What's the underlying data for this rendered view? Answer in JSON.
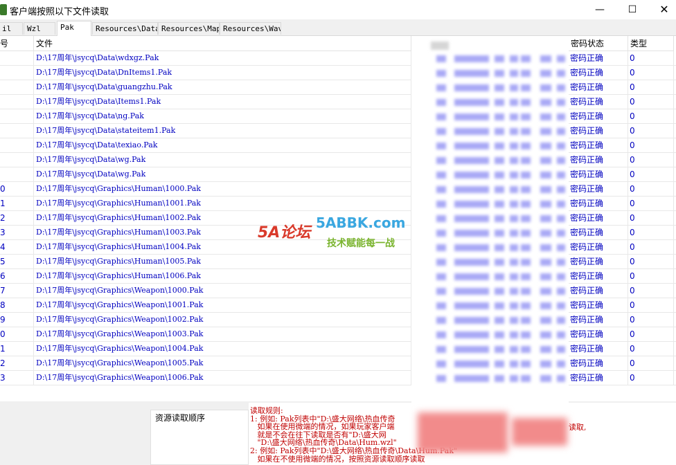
{
  "window": {
    "title": "客户端按照以下文件读取",
    "minimize": "—",
    "maximize": "☐",
    "close": "✕"
  },
  "tabs": [
    {
      "label": "il"
    },
    {
      "label": "Wzl"
    },
    {
      "label": "Pak"
    },
    {
      "label": "Resources\\Data"
    },
    {
      "label": "Resources\\Map"
    },
    {
      "label": "Resources\\Wav"
    }
  ],
  "table": {
    "headers": {
      "num": "序号",
      "file": "文件",
      "pw": "密码状态",
      "type": "类型"
    },
    "rows": [
      {
        "num": "",
        "file": "D:\\17周年\\jsycq\\Data\\wdxgz.Pak",
        "pw": "密码正确",
        "type": "0"
      },
      {
        "num": "",
        "file": "D:\\17周年\\jsycq\\Data\\DnItems1.Pak",
        "pw": "密码正确",
        "type": "0"
      },
      {
        "num": "",
        "file": "D:\\17周年\\jsycq\\Data\\guangzhu.Pak",
        "pw": "密码正确",
        "type": "0"
      },
      {
        "num": "",
        "file": "D:\\17周年\\jsycq\\Data\\Items1.Pak",
        "pw": "密码正确",
        "type": "0"
      },
      {
        "num": "",
        "file": "D:\\17周年\\jsycq\\Data\\ng.Pak",
        "pw": "密码正确",
        "type": "0"
      },
      {
        "num": "",
        "file": "D:\\17周年\\jsycq\\Data\\stateitem1.Pak",
        "pw": "密码正确",
        "type": "0"
      },
      {
        "num": "",
        "file": "D:\\17周年\\jsycq\\Data\\texiao.Pak",
        "pw": "密码正确",
        "type": "0"
      },
      {
        "num": "",
        "file": "D:\\17周年\\jsycq\\Data\\wg.Pak",
        "pw": "密码正确",
        "type": "0"
      },
      {
        "num": "",
        "file": "D:\\17周年\\jsycq\\Data\\wg.Pak",
        "pw": "密码正确",
        "type": "0"
      },
      {
        "num": "0",
        "file": "D:\\17周年\\jsycq\\Graphics\\Human\\1000.Pak",
        "pw": "密码正确",
        "type": "0"
      },
      {
        "num": "1",
        "file": "D:\\17周年\\jsycq\\Graphics\\Human\\1001.Pak",
        "pw": "密码正确",
        "type": "0"
      },
      {
        "num": "2",
        "file": "D:\\17周年\\jsycq\\Graphics\\Human\\1002.Pak",
        "pw": "密码正确",
        "type": "0"
      },
      {
        "num": "3",
        "file": "D:\\17周年\\jsycq\\Graphics\\Human\\1003.Pak",
        "pw": "密码正确",
        "type": "0"
      },
      {
        "num": "4",
        "file": "D:\\17周年\\jsycq\\Graphics\\Human\\1004.Pak",
        "pw": "密码正确",
        "type": "0"
      },
      {
        "num": "5",
        "file": "D:\\17周年\\jsycq\\Graphics\\Human\\1005.Pak",
        "pw": "密码正确",
        "type": "0"
      },
      {
        "num": "6",
        "file": "D:\\17周年\\jsycq\\Graphics\\Human\\1006.Pak",
        "pw": "密码正确",
        "type": "0"
      },
      {
        "num": "7",
        "file": "D:\\17周年\\jsycq\\Graphics\\Weapon\\1000.Pak",
        "pw": "密码正确",
        "type": "0"
      },
      {
        "num": "8",
        "file": "D:\\17周年\\jsycq\\Graphics\\Weapon\\1001.Pak",
        "pw": "密码正确",
        "type": "0"
      },
      {
        "num": "9",
        "file": "D:\\17周年\\jsycq\\Graphics\\Weapon\\1002.Pak",
        "pw": "密码正确",
        "type": "0"
      },
      {
        "num": "0",
        "file": "D:\\17周年\\jsycq\\Graphics\\Weapon\\1003.Pak",
        "pw": "密码正确",
        "type": "0"
      },
      {
        "num": "1",
        "file": "D:\\17周年\\jsycq\\Graphics\\Weapon\\1004.Pak",
        "pw": "密码正确",
        "type": "0"
      },
      {
        "num": "2",
        "file": "D:\\17周年\\jsycq\\Graphics\\Weapon\\1005.Pak",
        "pw": "密码正确",
        "type": "0"
      },
      {
        "num": "3",
        "file": "D:\\17周年\\jsycq\\Graphics\\Weapon\\1006.Pak",
        "pw": "密码正确",
        "type": "0"
      }
    ]
  },
  "bottom": {
    "order_label": "资源读取顺序",
    "rules": [
      "读取规则:",
      "1: 例如: Pak列表中\"D:\\盛大网络\\热血传奇",
      "   如果在使用微端的情况，如果玩家客户端",
      "   就是不会在往下读取是否有\"D:\\盛大网",
      "   \"D:\\盛大网络\\热血传奇\\Data\\Hum.wzl\"",
      "2: 例如: Pak列表中\"D:\\盛大网络\\热血传奇\\Data\\Hum.Pak\"",
      "   如果在不使用微端的情况，按照资源读取顺序读取"
    ],
    "rules_tail": "读取,"
  },
  "watermark": {
    "logo": "5A论坛",
    "domain": "5ABBK.com",
    "slogan": "技术赋能每一战"
  },
  "colors": {
    "link_text": "#0000c0",
    "rules_text": "#c00000"
  }
}
